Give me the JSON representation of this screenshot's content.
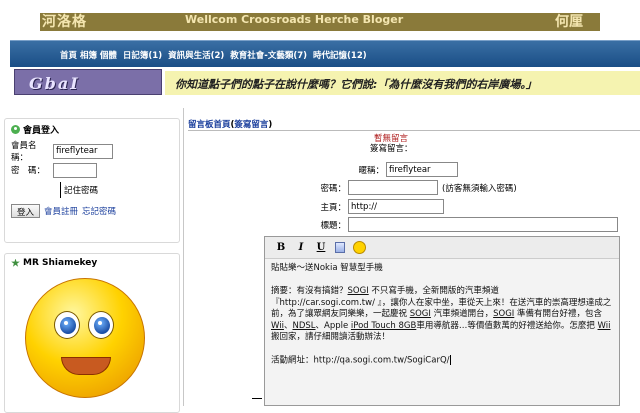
{
  "header": {
    "site_name": "河洛格",
    "slogan": "Wellcom Croosroads Herche Bloger",
    "owner": "何厘"
  },
  "nav": {
    "items": [
      "首頁 相簿 個體",
      "日記簿(1)",
      "資訊與生活(2)",
      "教育社會-文藝類(7)",
      "時代記憶(12)"
    ]
  },
  "banner": {
    "logo_text": "GbaI",
    "marquee": "你知道點子們的點子在說什麼嗎？它們說:「為什麼沒有我們的右岸廣場。」"
  },
  "login": {
    "title": "會員登入",
    "username_label": "會員名稱：",
    "username_value": "fireflytear",
    "password_label": "密　碼：",
    "password_value": "",
    "remember_label": "記住密碼",
    "login_button": "登入",
    "register_link": "會員註冊",
    "forgot_link": "忘記密碼"
  },
  "mr_panel": {
    "title": "MR Shiamekey"
  },
  "guestbook": {
    "tab_home": "留言板首頁",
    "tab_write": "簽寫留言",
    "no_message": "暫無留言",
    "my_message": "簽寫留言：",
    "nickname_label": "暱稱：",
    "nickname_value": "fireflytear",
    "password_label": "密碼：",
    "password_hint": "(訪客無須輸入密碼)",
    "homepage_label": "主頁：",
    "homepage_value": "http://",
    "subject_label": "標題：",
    "subject_value": ""
  },
  "editor": {
    "toolbar": {
      "bold": "B",
      "italic": "I",
      "underline": "U"
    },
    "body_line1": "貼貼樂～送Nokia 智慧型手機",
    "body_summary_1": "摘要：有沒有搞錯？",
    "body_sogi_1": "SOGI",
    "body_summary_2": " 不只寫手機，全新開版的汽車頻道",
    "body_url_1": "『http://car.sogi.com.tw/ 』",
    "body_summary_3": "，讓你人在家中坐，車從天上來！在送汽車的崇高理想達成之前，為了讓眾網友同樂樂，一起慶祝 ",
    "body_sogi_2": "SOGI",
    "body_summary_4": " 汽車頻道開台，",
    "body_sogi_3": "SOGI",
    "body_summary_5": " 準備有開台好禮，包含 ",
    "body_wii_1": "Wii",
    "body_summary_6": "、",
    "body_ndsl": "NDSL",
    "body_summary_7": "、Apple ",
    "body_ipod": "iPod Touch 8GB",
    "body_summary_8": "車用導航器…等價值數萬的好禮送給你。怎麼把 ",
    "body_wii_2": "Wii",
    "body_summary_9": " 搬回家，請仔細閱讀活動辦法！",
    "body_activity_label": "活動網址：",
    "body_activity_url": "http://qa.sogi.com.tw/SogiCarQ/"
  }
}
